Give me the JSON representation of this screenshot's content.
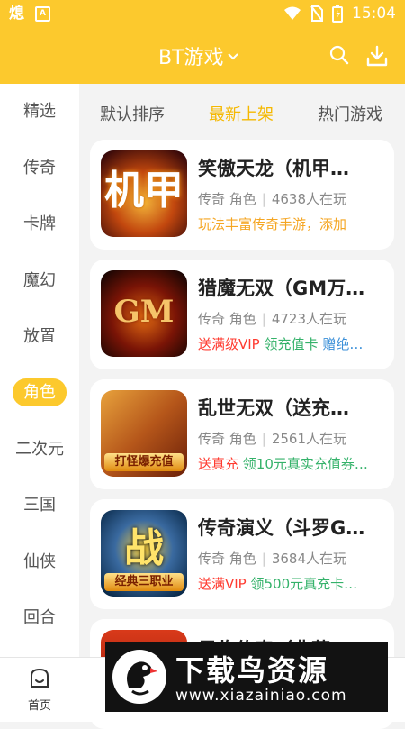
{
  "statusbar": {
    "time": "15:04"
  },
  "header": {
    "title": "BT游戏"
  },
  "sidebar": {
    "items": [
      {
        "label": "精选"
      },
      {
        "label": "传奇"
      },
      {
        "label": "卡牌"
      },
      {
        "label": "魔幻"
      },
      {
        "label": "放置"
      },
      {
        "label": "角色"
      },
      {
        "label": "二次元"
      },
      {
        "label": "三国"
      },
      {
        "label": "仙侠"
      },
      {
        "label": "回合"
      }
    ],
    "active": "角色"
  },
  "tabs": [
    {
      "label": "默认排序"
    },
    {
      "label": "最新上架"
    },
    {
      "label": "热门游戏"
    }
  ],
  "games": [
    {
      "name": "笑傲天龙（机甲…",
      "tags": "传奇 角色",
      "players": "4638人在玩",
      "promo": [
        {
          "text": "玩法丰富传奇手游，添加",
          "color": "orange"
        }
      ],
      "art_text": "机甲",
      "colors": [
        "#3a0a0a",
        "#c2470e",
        "#f2b43a"
      ]
    },
    {
      "name": "猎魔无双（GM万…",
      "tags": "传奇 角色",
      "players": "4723人在玩",
      "promo": [
        {
          "text": "送满级VIP",
          "color": "red"
        },
        {
          "text": "领充值卡",
          "color": "green"
        },
        {
          "text": "赠绝…",
          "color": "blue"
        }
      ],
      "art_text": "GM",
      "colors": [
        "#1a0603",
        "#7a1406",
        "#e06a12"
      ]
    },
    {
      "name": "乱世无双（送充…",
      "tags": "传奇 角色",
      "players": "2561人在玩",
      "promo": [
        {
          "text": "送真充",
          "color": "red"
        },
        {
          "text": "领10元真实充值券…",
          "color": "green"
        }
      ],
      "art_text": "打怪爆充值",
      "colors": [
        "#6b1f08",
        "#b5561a",
        "#e8a23c"
      ]
    },
    {
      "name": "传奇演义（斗罗G…",
      "tags": "传奇 角色",
      "players": "3684人在玩",
      "promo": [
        {
          "text": "送满VIP",
          "color": "red"
        },
        {
          "text": "领500元真充卡…",
          "color": "green"
        }
      ],
      "art_text": "战",
      "ribbon": "经典三职业",
      "colors": [
        "#0a2a4a",
        "#3a6aa0",
        "#ffd23a"
      ]
    }
  ],
  "partial_game": {
    "name": "君临传奇（典藏…"
  },
  "bottombar": {
    "home_label": "首页"
  },
  "watermark": {
    "title": "下载鸟资源",
    "url": "www.xiazainiao.com"
  }
}
